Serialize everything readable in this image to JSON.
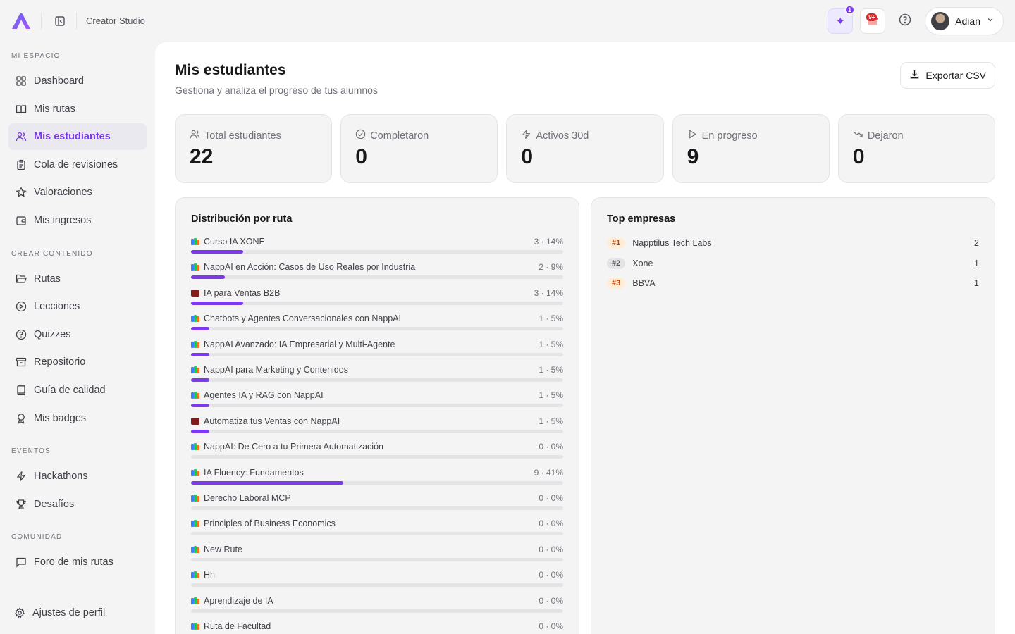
{
  "header": {
    "app_title": "Creator Studio",
    "sparkle_badge": "1",
    "gift_badge": "9+",
    "user_name": "Adian"
  },
  "sidebar": {
    "sections": [
      {
        "label": "MI ESPACIO"
      },
      {
        "label": "CREAR CONTENIDO"
      },
      {
        "label": "EVENTOS"
      },
      {
        "label": "COMUNIDAD"
      }
    ],
    "items": [
      {
        "label": "Dashboard",
        "icon": "grid-icon"
      },
      {
        "label": "Mis rutas",
        "icon": "book-open-icon"
      },
      {
        "label": "Mis estudiantes",
        "icon": "users-icon"
      },
      {
        "label": "Cola de revisiones",
        "icon": "clipboard-icon"
      },
      {
        "label": "Valoraciones",
        "icon": "star-icon"
      },
      {
        "label": "Mis ingresos",
        "icon": "wallet-icon"
      },
      {
        "label": "Rutas",
        "icon": "folder-open-icon"
      },
      {
        "label": "Lecciones",
        "icon": "play-circle-icon"
      },
      {
        "label": "Quizzes",
        "icon": "help-circle-icon"
      },
      {
        "label": "Repositorio",
        "icon": "archive-icon"
      },
      {
        "label": "Guía de calidad",
        "icon": "book-icon"
      },
      {
        "label": "Mis badges",
        "icon": "award-icon"
      },
      {
        "label": "Hackathons",
        "icon": "zap-icon"
      },
      {
        "label": "Desafíos",
        "icon": "trophy-icon"
      },
      {
        "label": "Foro de mis rutas",
        "icon": "message-square-icon"
      }
    ],
    "settings_label": "Ajustes de perfil"
  },
  "page": {
    "title": "Mis estudiantes",
    "subtitle": "Gestiona y analiza el progreso de tus alumnos",
    "export_label": "Exportar CSV"
  },
  "stats": [
    {
      "label": "Total estudiantes",
      "value": "22",
      "icon": "users-icon"
    },
    {
      "label": "Completaron",
      "value": "0",
      "icon": "check-circle-icon"
    },
    {
      "label": "Activos 30d",
      "value": "0",
      "icon": "zap-icon"
    },
    {
      "label": "En progreso",
      "value": "9",
      "icon": "play-icon"
    },
    {
      "label": "Dejaron",
      "value": "0",
      "icon": "trending-down-icon"
    }
  ],
  "distribution": {
    "title": "Distribución por ruta",
    "routes": [
      {
        "name": "Curso IA XONE",
        "count": "3 · 14%",
        "pct": 14,
        "emoji": "books"
      },
      {
        "name": "NappAI en Acción: Casos de Uso Reales por Industria",
        "count": "2 · 9%",
        "pct": 9,
        "emoji": "books"
      },
      {
        "name": "IA para Ventas B2B",
        "count": "3 · 14%",
        "pct": 14,
        "emoji": "briefcase"
      },
      {
        "name": "Chatbots y Agentes Conversacionales con NappAI",
        "count": "1 · 5%",
        "pct": 5,
        "emoji": "books"
      },
      {
        "name": "NappAI Avanzado: IA Empresarial y Multi-Agente",
        "count": "1 · 5%",
        "pct": 5,
        "emoji": "books"
      },
      {
        "name": "NappAI para Marketing y Contenidos",
        "count": "1 · 5%",
        "pct": 5,
        "emoji": "books"
      },
      {
        "name": "Agentes IA y RAG con NappAI",
        "count": "1 · 5%",
        "pct": 5,
        "emoji": "books"
      },
      {
        "name": "Automatiza tus Ventas con NappAI",
        "count": "1 · 5%",
        "pct": 5,
        "emoji": "briefcase"
      },
      {
        "name": "NappAI: De Cero a tu Primera Automatización",
        "count": "0 · 0%",
        "pct": 0,
        "emoji": "books"
      },
      {
        "name": "IA Fluency: Fundamentos",
        "count": "9 · 41%",
        "pct": 41,
        "emoji": "books"
      },
      {
        "name": "Derecho Laboral MCP",
        "count": "0 · 0%",
        "pct": 0,
        "emoji": "books"
      },
      {
        "name": "Principles of Business Economics",
        "count": "0 · 0%",
        "pct": 0,
        "emoji": "books"
      },
      {
        "name": "New Rute",
        "count": "0 · 0%",
        "pct": 0,
        "emoji": "books"
      },
      {
        "name": "Hh",
        "count": "0 · 0%",
        "pct": 0,
        "emoji": "books"
      },
      {
        "name": "Aprendizaje de IA",
        "count": "0 · 0%",
        "pct": 0,
        "emoji": "books"
      },
      {
        "name": "Ruta de Facultad",
        "count": "0 · 0%",
        "pct": 0,
        "emoji": "books"
      }
    ]
  },
  "top_companies": {
    "title": "Top empresas",
    "items": [
      {
        "rank": "#1",
        "name": "Napptilus Tech Labs",
        "count": "2"
      },
      {
        "rank": "#2",
        "name": "Xone",
        "count": "1"
      },
      {
        "rank": "#3",
        "name": "BBVA",
        "count": "1"
      }
    ]
  },
  "colors": {
    "accent": "#7c3aed",
    "background": "#f4f4f5",
    "panel": "#ffffff"
  }
}
